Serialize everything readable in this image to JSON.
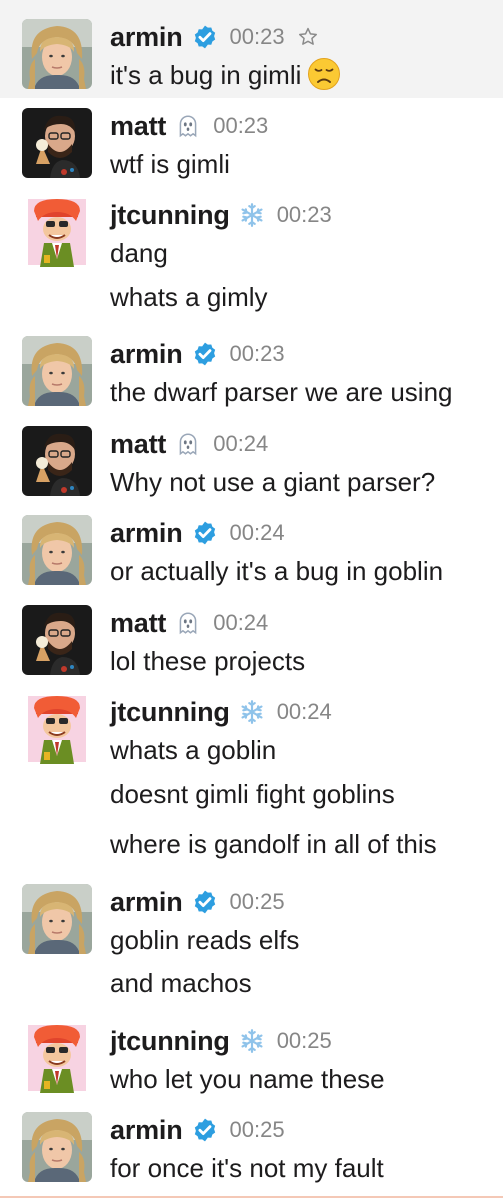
{
  "users": {
    "armin": {
      "name": "armin",
      "badge": "verified-check-icon",
      "badge_color": "#2d9ee0"
    },
    "matt": {
      "name": "matt",
      "badge": "ghost-icon",
      "badge_color": "#9aa7b8"
    },
    "jtcunning": {
      "name": "jtcunning",
      "badge": "snowflake-icon",
      "badge_color": "#8fc3ea"
    }
  },
  "messages": [
    {
      "user": "armin",
      "time": "00:23",
      "lines": [
        "it's a bug in gimli"
      ],
      "emoji": "disappointed-face-icon",
      "starred": true
    },
    {
      "user": "matt",
      "time": "00:23",
      "lines": [
        "wtf is gimli"
      ]
    },
    {
      "user": "jtcunning",
      "time": "00:23",
      "lines": [
        "dang",
        "whats a gimly"
      ]
    },
    {
      "user": "armin",
      "time": "00:23",
      "lines": [
        "the dwarf parser we are using"
      ]
    },
    {
      "user": "matt",
      "time": "00:24",
      "lines": [
        "Why not use a giant parser?"
      ]
    },
    {
      "user": "armin",
      "time": "00:24",
      "lines": [
        "or actually it's a bug in goblin"
      ]
    },
    {
      "user": "matt",
      "time": "00:24",
      "lines": [
        "lol these projects"
      ]
    },
    {
      "user": "jtcunning",
      "time": "00:24",
      "lines": [
        "whats a goblin",
        "doesnt gimli fight goblins",
        "where is gandolf in all of this"
      ]
    },
    {
      "user": "armin",
      "time": "00:25",
      "lines": [
        "goblin reads elfs",
        "and machos"
      ]
    },
    {
      "user": "jtcunning",
      "time": "00:25",
      "lines": [
        "who let you name these"
      ]
    },
    {
      "user": "armin",
      "time": "00:25",
      "lines": [
        "for once it's not my fault"
      ]
    }
  ]
}
